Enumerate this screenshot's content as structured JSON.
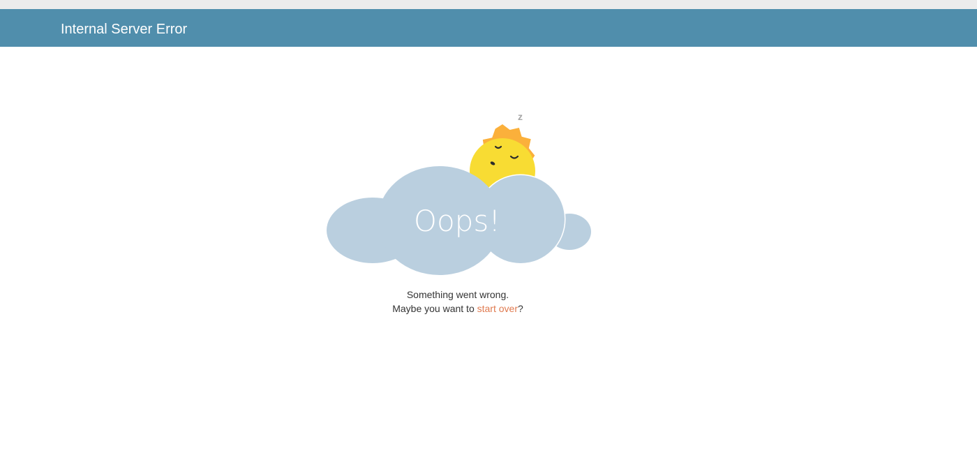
{
  "header": {
    "title": "Internal Server Error"
  },
  "illustration": {
    "headline": "Oops!",
    "zzz": "z",
    "icons": [
      "sleeping-sun-icon",
      "cloud-icon"
    ],
    "colors": {
      "cloud": "#bacfdf",
      "sun_face": "#f8dc33",
      "sun_rays": "#fbb03b",
      "zzz": "#a6a6a6",
      "headline": "#ffffff"
    }
  },
  "message": {
    "line1": "Something went wrong.",
    "line2_prefix": "Maybe you want to ",
    "link_label": "start over",
    "line2_suffix": "?"
  },
  "colors": {
    "header_bg": "#508eac",
    "top_strip": "#ececec",
    "link": "#e07a4f",
    "text": "#333333"
  }
}
